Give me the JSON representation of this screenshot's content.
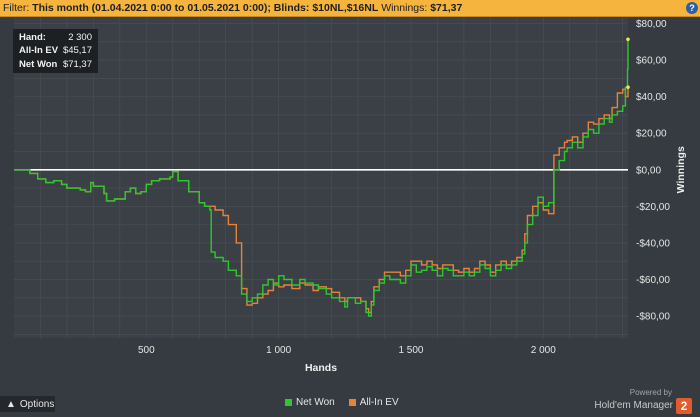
{
  "filter_bar": {
    "prefix": "Filter:",
    "month": "This month (01.04.2021 0:00 to 01.05.2021 0:00);",
    "blinds_label": "Blinds:",
    "blinds_value": "$10NL,$16NL",
    "winnings_label": "Winnings:",
    "winnings_value": "$71,37",
    "help": "?"
  },
  "tooltip": {
    "rows": [
      {
        "label": "Hand:",
        "value": "2 300"
      },
      {
        "label": "All-In EV",
        "value": "$45,17"
      },
      {
        "label": "Net Won",
        "value": "$71,37"
      }
    ]
  },
  "options_label": "Options",
  "brand": {
    "powered": "Powered by",
    "name": "Hold'em Manager",
    "logo": "2"
  },
  "colors": {
    "net_won": "#2ec82e",
    "all_in_ev": "#e8823a",
    "zero_line": "#ffffff",
    "grid": "#4a5056",
    "marker": "#e8e85a"
  },
  "chart_data": {
    "type": "line",
    "xlabel": "Hands",
    "ylabel": "Winnings",
    "xlim": [
      0,
      2320
    ],
    "ylim": [
      -92,
      83
    ],
    "x_ticks": [
      500,
      1000,
      1500,
      2000
    ],
    "x_tick_labels": [
      "500",
      "1 000",
      "1 500",
      "2 000"
    ],
    "y_ticks": [
      80,
      60,
      40,
      20,
      0,
      -20,
      -40,
      -60,
      -80
    ],
    "y_tick_labels": [
      "$80,00",
      "$60,00",
      "$40,00",
      "$20,00",
      "$0,00",
      "-$20,00",
      "-$40,00",
      "-$60,00",
      "-$80,00"
    ],
    "legend_position": "bottom",
    "series": [
      {
        "name": "Net Won",
        "points": [
          [
            0,
            0
          ],
          [
            40,
            0
          ],
          [
            60,
            -2
          ],
          [
            90,
            -5
          ],
          [
            120,
            -7
          ],
          [
            150,
            -6
          ],
          [
            180,
            -8
          ],
          [
            200,
            -10
          ],
          [
            220,
            -10
          ],
          [
            250,
            -11
          ],
          [
            270,
            -12
          ],
          [
            290,
            -7
          ],
          [
            300,
            -9
          ],
          [
            340,
            -13
          ],
          [
            350,
            -17
          ],
          [
            380,
            -16
          ],
          [
            420,
            -12
          ],
          [
            440,
            -10
          ],
          [
            460,
            -13
          ],
          [
            480,
            -12
          ],
          [
            500,
            -8
          ],
          [
            520,
            -6
          ],
          [
            550,
            -5
          ],
          [
            590,
            -4
          ],
          [
            600,
            -1
          ],
          [
            620,
            -6
          ],
          [
            660,
            -12
          ],
          [
            700,
            -18
          ],
          [
            720,
            -20
          ],
          [
            740,
            -22
          ],
          [
            745,
            -45
          ],
          [
            760,
            -48
          ],
          [
            790,
            -50
          ],
          [
            810,
            -55
          ],
          [
            840,
            -58
          ],
          [
            860,
            -68
          ],
          [
            880,
            -72
          ],
          [
            900,
            -70
          ],
          [
            920,
            -68
          ],
          [
            940,
            -63
          ],
          [
            960,
            -60
          ],
          [
            980,
            -63
          ],
          [
            1000,
            -58
          ],
          [
            1020,
            -60
          ],
          [
            1050,
            -63
          ],
          [
            1080,
            -60
          ],
          [
            1100,
            -62
          ],
          [
            1130,
            -63
          ],
          [
            1150,
            -65
          ],
          [
            1180,
            -68
          ],
          [
            1200,
            -70
          ],
          [
            1230,
            -72
          ],
          [
            1250,
            -75
          ],
          [
            1260,
            -70
          ],
          [
            1290,
            -73
          ],
          [
            1310,
            -72
          ],
          [
            1330,
            -78
          ],
          [
            1340,
            -80
          ],
          [
            1350,
            -74
          ],
          [
            1360,
            -66
          ],
          [
            1380,
            -62
          ],
          [
            1400,
            -58
          ],
          [
            1420,
            -60
          ],
          [
            1440,
            -60
          ],
          [
            1460,
            -62
          ],
          [
            1480,
            -58
          ],
          [
            1500,
            -52
          ],
          [
            1520,
            -56
          ],
          [
            1540,
            -55
          ],
          [
            1560,
            -53
          ],
          [
            1580,
            -55
          ],
          [
            1600,
            -58
          ],
          [
            1620,
            -54
          ],
          [
            1640,
            -55
          ],
          [
            1660,
            -58
          ],
          [
            1680,
            -58
          ],
          [
            1700,
            -56
          ],
          [
            1720,
            -58
          ],
          [
            1740,
            -56
          ],
          [
            1760,
            -52
          ],
          [
            1780,
            -54
          ],
          [
            1800,
            -58
          ],
          [
            1820,
            -55
          ],
          [
            1840,
            -52
          ],
          [
            1860,
            -54
          ],
          [
            1880,
            -52
          ],
          [
            1900,
            -50
          ],
          [
            1920,
            -46
          ],
          [
            1930,
            -40
          ],
          [
            1940,
            -30
          ],
          [
            1960,
            -25
          ],
          [
            1980,
            -15
          ],
          [
            2000,
            -20
          ],
          [
            2020,
            -18
          ],
          [
            2040,
            0
          ],
          [
            2060,
            5
          ],
          [
            2080,
            10
          ],
          [
            2090,
            12
          ],
          [
            2110,
            15
          ],
          [
            2130,
            12
          ],
          [
            2150,
            18
          ],
          [
            2170,
            22
          ],
          [
            2190,
            20
          ],
          [
            2210,
            25
          ],
          [
            2230,
            28
          ],
          [
            2250,
            26
          ],
          [
            2260,
            30
          ],
          [
            2280,
            32
          ],
          [
            2300,
            35
          ],
          [
            2310,
            45
          ],
          [
            2318,
            55
          ],
          [
            2320,
            71.37
          ]
        ]
      },
      {
        "name": "All-In EV",
        "points": [
          [
            0,
            0
          ],
          [
            40,
            0
          ],
          [
            60,
            -2
          ],
          [
            90,
            -5
          ],
          [
            120,
            -7
          ],
          [
            150,
            -6
          ],
          [
            180,
            -8
          ],
          [
            200,
            -10
          ],
          [
            220,
            -10
          ],
          [
            250,
            -11
          ],
          [
            270,
            -12
          ],
          [
            290,
            -7
          ],
          [
            300,
            -9
          ],
          [
            340,
            -13
          ],
          [
            350,
            -17
          ],
          [
            380,
            -16
          ],
          [
            420,
            -12
          ],
          [
            440,
            -10
          ],
          [
            460,
            -13
          ],
          [
            480,
            -12
          ],
          [
            500,
            -8
          ],
          [
            520,
            -6
          ],
          [
            550,
            -5
          ],
          [
            590,
            -4
          ],
          [
            600,
            -1
          ],
          [
            620,
            -6
          ],
          [
            660,
            -12
          ],
          [
            700,
            -18
          ],
          [
            720,
            -20
          ],
          [
            740,
            -20
          ],
          [
            760,
            -22
          ],
          [
            790,
            -25
          ],
          [
            810,
            -30
          ],
          [
            840,
            -40
          ],
          [
            860,
            -65
          ],
          [
            880,
            -74
          ],
          [
            900,
            -73
          ],
          [
            920,
            -70
          ],
          [
            940,
            -68
          ],
          [
            960,
            -66
          ],
          [
            980,
            -62
          ],
          [
            1000,
            -64
          ],
          [
            1020,
            -63
          ],
          [
            1050,
            -65
          ],
          [
            1080,
            -62
          ],
          [
            1100,
            -63
          ],
          [
            1130,
            -66
          ],
          [
            1150,
            -64
          ],
          [
            1180,
            -65
          ],
          [
            1200,
            -67
          ],
          [
            1230,
            -70
          ],
          [
            1250,
            -72
          ],
          [
            1260,
            -70
          ],
          [
            1290,
            -70
          ],
          [
            1310,
            -72
          ],
          [
            1330,
            -76
          ],
          [
            1340,
            -78
          ],
          [
            1350,
            -72
          ],
          [
            1360,
            -64
          ],
          [
            1380,
            -60
          ],
          [
            1400,
            -56
          ],
          [
            1420,
            -56
          ],
          [
            1440,
            -56
          ],
          [
            1460,
            -58
          ],
          [
            1480,
            -55
          ],
          [
            1500,
            -50
          ],
          [
            1520,
            -50
          ],
          [
            1540,
            -52
          ],
          [
            1560,
            -50
          ],
          [
            1580,
            -52
          ],
          [
            1600,
            -54
          ],
          [
            1620,
            -52
          ],
          [
            1640,
            -52
          ],
          [
            1660,
            -55
          ],
          [
            1680,
            -56
          ],
          [
            1700,
            -54
          ],
          [
            1720,
            -56
          ],
          [
            1740,
            -54
          ],
          [
            1760,
            -50
          ],
          [
            1780,
            -52
          ],
          [
            1800,
            -56
          ],
          [
            1820,
            -52
          ],
          [
            1840,
            -50
          ],
          [
            1860,
            -52
          ],
          [
            1880,
            -50
          ],
          [
            1900,
            -48
          ],
          [
            1920,
            -44
          ],
          [
            1930,
            -35
          ],
          [
            1940,
            -25
          ],
          [
            1960,
            -20
          ],
          [
            1980,
            -18
          ],
          [
            2000,
            -22
          ],
          [
            2020,
            -24
          ],
          [
            2040,
            8
          ],
          [
            2060,
            12
          ],
          [
            2080,
            15
          ],
          [
            2090,
            16
          ],
          [
            2110,
            18
          ],
          [
            2130,
            15
          ],
          [
            2150,
            20
          ],
          [
            2170,
            26
          ],
          [
            2190,
            25
          ],
          [
            2210,
            28
          ],
          [
            2230,
            30
          ],
          [
            2250,
            28
          ],
          [
            2260,
            34
          ],
          [
            2280,
            42
          ],
          [
            2300,
            44
          ],
          [
            2310,
            40
          ],
          [
            2320,
            45.17
          ]
        ]
      }
    ]
  }
}
